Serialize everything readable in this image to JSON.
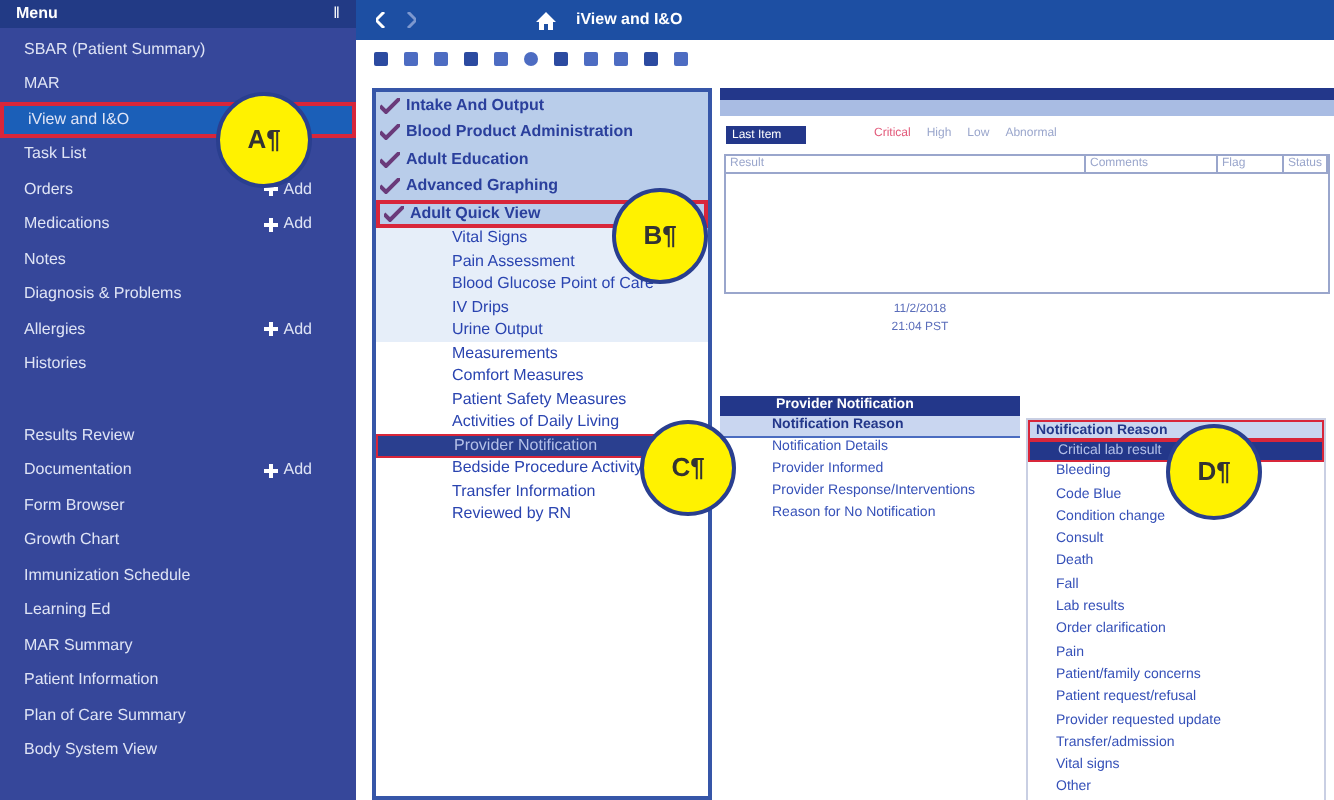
{
  "menu": {
    "title": "Menu",
    "pin": "ǁ",
    "items": [
      {
        "label": "SBAR (Patient Summary)",
        "selected": false
      },
      {
        "label": "MAR",
        "selected": false
      },
      {
        "label": "iView and I&O",
        "selected": true
      },
      {
        "label": "Task List",
        "selected": false
      },
      {
        "label": "Orders",
        "selected": false,
        "add": "Add"
      },
      {
        "label": "Medications",
        "selected": false,
        "add": "Add"
      },
      {
        "label": "Notes",
        "selected": false
      },
      {
        "label": "Diagnosis & Problems",
        "selected": false
      },
      {
        "label": "Allergies",
        "selected": false,
        "add": "Add"
      },
      {
        "label": "Histories",
        "selected": false
      },
      {
        "kind": "gap"
      },
      {
        "label": "Results Review",
        "selected": false
      },
      {
        "label": "Documentation",
        "selected": false,
        "add": "Add"
      },
      {
        "label": "Form Browser",
        "selected": false
      },
      {
        "label": "Growth Chart",
        "selected": false
      },
      {
        "label": "Immunization Schedule",
        "selected": false
      },
      {
        "label": "Learning Ed",
        "selected": false
      },
      {
        "label": "MAR Summary",
        "selected": false
      },
      {
        "label": "Patient Information",
        "selected": false
      },
      {
        "label": "Plan of Care Summary",
        "selected": false
      },
      {
        "label": "Body System View",
        "selected": false
      }
    ]
  },
  "header": {
    "title": "iView and I&O"
  },
  "bands": [
    {
      "label": "Intake And Output",
      "selected": false
    },
    {
      "label": "Blood Product Administration",
      "selected": false
    },
    {
      "label": "Adult Education",
      "selected": false
    },
    {
      "label": "Advanced Graphing",
      "selected": false
    },
    {
      "label": "Adult Quick View",
      "selected": true
    }
  ],
  "sections": [
    {
      "label": "Vital Signs",
      "selected": false
    },
    {
      "label": "Pain Assessment",
      "selected": false
    },
    {
      "label": "Blood Glucose Point of Care",
      "selected": false
    },
    {
      "label": "IV Drips",
      "selected": false
    },
    {
      "label": "Urine Output",
      "selected": false
    },
    {
      "label": "Measurements",
      "selected": false
    },
    {
      "label": "Comfort Measures",
      "selected": false
    },
    {
      "label": "Patient Safety Measures",
      "selected": false
    },
    {
      "label": "Activities of Daily Living",
      "selected": false
    },
    {
      "label": "Provider Notification",
      "selected": true
    },
    {
      "label": "Bedside Procedure Activity",
      "selected": false
    },
    {
      "label": "Transfer Information",
      "selected": false
    },
    {
      "label": "Reviewed by RN",
      "selected": false
    }
  ],
  "grid": {
    "button": "Last Item",
    "legend": [
      "Critical",
      "High",
      "Low",
      "Abnormal"
    ],
    "columns": [
      "Result",
      "Comments",
      "Flag",
      "Status"
    ],
    "date": "11/2/2018",
    "time": "21:04 PST"
  },
  "notification": {
    "title": "Provider Notification",
    "rows": [
      {
        "label": "Notification Reason",
        "selected": true
      },
      {
        "label": "Notification Details",
        "selected": false
      },
      {
        "label": "Provider Informed",
        "selected": false
      },
      {
        "label": "Provider Response/Interventions",
        "selected": false
      },
      {
        "label": "Reason for No Notification",
        "selected": false
      }
    ]
  },
  "dropdown": {
    "title": "Notification Reason",
    "options": [
      {
        "label": "Critical lab result",
        "selected": true
      },
      {
        "label": "Bleeding",
        "selected": false
      },
      {
        "label": "Code Blue",
        "selected": false
      },
      {
        "label": "Condition change",
        "selected": false
      },
      {
        "label": "Consult",
        "selected": false
      },
      {
        "label": "Death",
        "selected": false
      },
      {
        "label": "Fall",
        "selected": false
      },
      {
        "label": "Lab results",
        "selected": false
      },
      {
        "label": "Order clarification",
        "selected": false
      },
      {
        "label": "Pain",
        "selected": false
      },
      {
        "label": "Patient/family concerns",
        "selected": false
      },
      {
        "label": "Patient request/refusal",
        "selected": false
      },
      {
        "label": "Provider requested update",
        "selected": false
      },
      {
        "label": "Transfer/admission",
        "selected": false
      },
      {
        "label": "Vital signs",
        "selected": false
      },
      {
        "label": "Other",
        "selected": false
      }
    ]
  },
  "callouts": [
    "A¶",
    "B¶",
    "C¶",
    "D¶"
  ]
}
